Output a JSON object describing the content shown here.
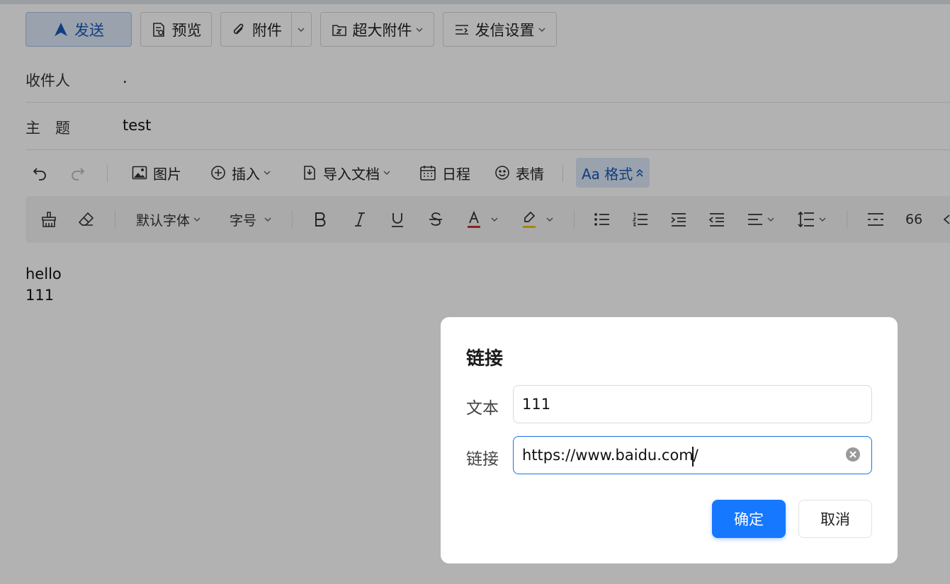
{
  "toolbar": {
    "send_label": "发送",
    "preview_label": "预览",
    "attach_label": "附件",
    "big_attach_label": "超大附件",
    "send_settings_label": "发信设置"
  },
  "fields": {
    "to_label": "收件人",
    "to_value": ".",
    "subject_label": "主　题",
    "subject_value": "test"
  },
  "editor_toolbar": {
    "image_label": "图片",
    "insert_label": "插入",
    "import_doc_label": "导入文档",
    "schedule_label": "日程",
    "emoji_label": "表情",
    "format_label": "Aa 格式"
  },
  "format_toolbar": {
    "font_label": "默认字体",
    "size_label": "字号",
    "quote_label": "66",
    "font_color": "#d32f2f",
    "highlight_color": "#f2c200"
  },
  "editor": {
    "lines": [
      "hello",
      "111"
    ]
  },
  "dialog": {
    "title": "链接",
    "text_label": "文本",
    "text_value": "111",
    "link_label": "链接",
    "link_value": "https://www.baidu.com/",
    "ok_label": "确定",
    "cancel_label": "取消"
  },
  "colors": {
    "accent": "#1677ff",
    "send_bg": "#dce8f8",
    "overlay": "rgba(0,0,0,0.3)"
  }
}
